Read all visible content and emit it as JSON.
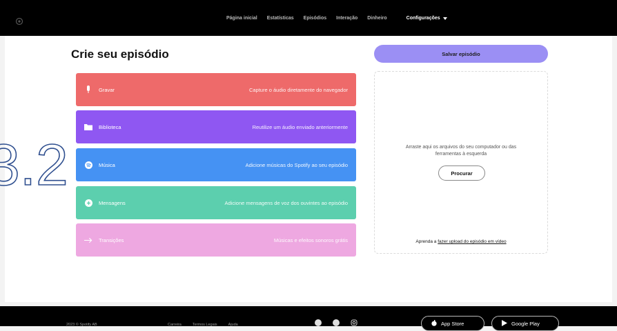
{
  "nav": {
    "links": [
      "Página inicial",
      "Estatísticas",
      "Episódios",
      "Interação",
      "Dinheiro"
    ],
    "settings_label": "Configurações"
  },
  "main": {
    "title": "Crie seu episódio",
    "cards": [
      {
        "label": "Gravar",
        "desc": "Capture o áudio diretamente do navegador",
        "icon": "microphone-icon",
        "color": "#ee6a6a"
      },
      {
        "label": "Biblioteca",
        "desc": "Reutilize um áudio enviado anteriormente",
        "icon": "folder-icon",
        "color": "#8f57f2"
      },
      {
        "label": "Música",
        "desc": "Adicione músicas do Spotify ao seu episódio",
        "icon": "spotify-icon",
        "color": "#4592f3"
      },
      {
        "label": "Mensagens",
        "desc": "Adicione mensagens de voz dos ouvintes ao episódio",
        "icon": "plus-bubble-icon",
        "color": "#5ccfae"
      },
      {
        "label": "Transições",
        "desc": "Músicas e efeitos sonoros grátis",
        "icon": "arrow-right-icon",
        "color": "#eea8e1"
      }
    ]
  },
  "side": {
    "save_label": "Salvar episódio",
    "drop_text": "Arraste aqui os arquivos do seu computador ou das ferramentas à esquerda",
    "browse_label": "Procurar",
    "footer_prefix": "Aprenda a ",
    "footer_link": "fazer upload do episódio em vídeo"
  },
  "overlay": {
    "number": "3.2"
  },
  "footer": {
    "copyright": "2023 © Spotify AB",
    "links": [
      "Carreira",
      "Termos Legais",
      "Ajuda"
    ],
    "app_store": "App Store",
    "google_play": "Google Play"
  },
  "colors": {
    "accent": "#9b8ff4",
    "topbar": "#000000"
  }
}
